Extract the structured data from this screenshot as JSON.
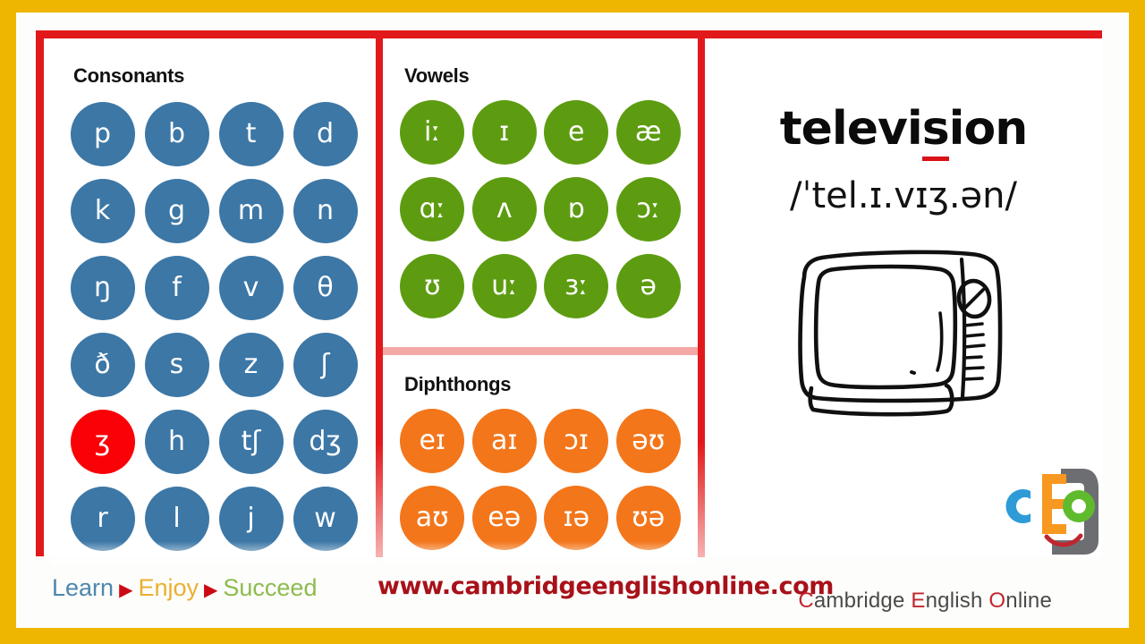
{
  "frame": {
    "outer_border_color": "#eeb600",
    "panel_border_color": "#e2191b",
    "divider_color": "#f4a9a6"
  },
  "panels": {
    "consonants": {
      "title": "Consonants",
      "circle_color": "#3c77a6",
      "highlight_color": "#fa0007",
      "symbols": [
        "p",
        "b",
        "t",
        "d",
        "k",
        "g",
        "m",
        "n",
        "ŋ",
        "f",
        "v",
        "θ",
        "ð",
        "s",
        "z",
        "ʃ",
        "ʒ",
        "h",
        "tʃ",
        "dʒ",
        "r",
        "l",
        "j",
        "w"
      ],
      "highlighted_symbol": "ʒ"
    },
    "vowels": {
      "title": "Vowels",
      "circle_color": "#5d9c11",
      "symbols": [
        "iː",
        "ɪ",
        "e",
        "æ",
        "ɑː",
        "ʌ",
        "ɒ",
        "ɔː",
        "ʊ",
        "uː",
        "ɜː",
        "ə"
      ]
    },
    "diphthongs": {
      "title": "Diphthongs",
      "circle_color": "#f3761b",
      "symbols": [
        "eɪ",
        "aɪ",
        "ɔɪ",
        "əʊ",
        "aʊ",
        "eə",
        "ɪə",
        "ʊə"
      ]
    },
    "word": {
      "headword_before": "televi",
      "headword_underlined": "s",
      "headword_after": "ion",
      "headword_full": "television",
      "transcription": "/ˈtel.ɪ.vɪʒ.ən/",
      "underline_color": "#d81216",
      "illustration": "television-drawing"
    }
  },
  "footer": {
    "tagline": {
      "learn": "Learn",
      "arrow": "▶",
      "enjoy": "Enjoy",
      "succeed": "Succeed",
      "learn_color": "#4e86ad",
      "enjoy_color": "#e9b02f",
      "succeed_color": "#8dbb4e",
      "arrow_color": "#cc0a14"
    },
    "url": "www.cambridgeenglishonline.com",
    "url_color": "#a8111a",
    "brand": {
      "logo_letters": [
        "c",
        "E",
        "o"
      ],
      "logo_c_color": "#2e9bd6",
      "logo_e_color": "#f79821",
      "logo_o_color": "#5fbb2d",
      "logo_bracket_color": "#6d6e71",
      "logo_smile_color": "#c0262f",
      "name_parts": [
        {
          "cap": "C",
          "rest": "ambridge"
        },
        {
          "cap": "E",
          "rest": "nglish"
        },
        {
          "cap": "O",
          "rest": "nline"
        }
      ]
    }
  }
}
